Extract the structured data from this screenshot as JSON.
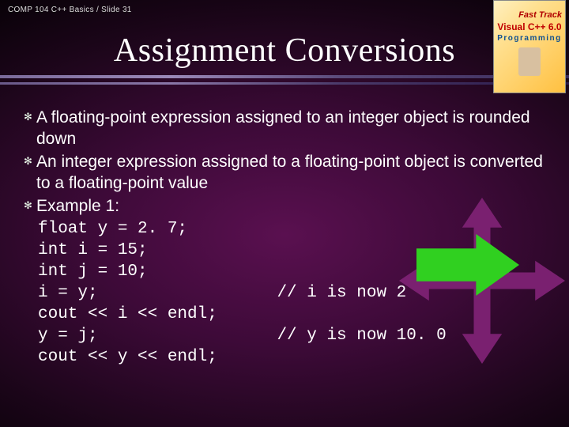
{
  "header": "COMP 104 C++ Basics / Slide 31",
  "title": "Assignment Conversions",
  "book": {
    "line1": "Fast Track",
    "line2": "Visual C++ 6.0",
    "line3": "Programming"
  },
  "bullets": [
    "A floating-point expression assigned to an integer object is rounded down",
    "An integer expression assigned to a floating-point object is converted to a floating-point value",
    "Example 1:"
  ],
  "code": {
    "l1": "float y = 2. 7;",
    "l2": "int i = 15;",
    "l3": "int j = 10;",
    "l4": "i = y;                  // i is now 2",
    "l5": "cout << i << endl;",
    "l6": "y = j;                  // y is now 10. 0",
    "l7": "cout << y << endl;"
  },
  "colors": {
    "bigArrow": "#7a2070",
    "smallArrow": "#30d020"
  }
}
